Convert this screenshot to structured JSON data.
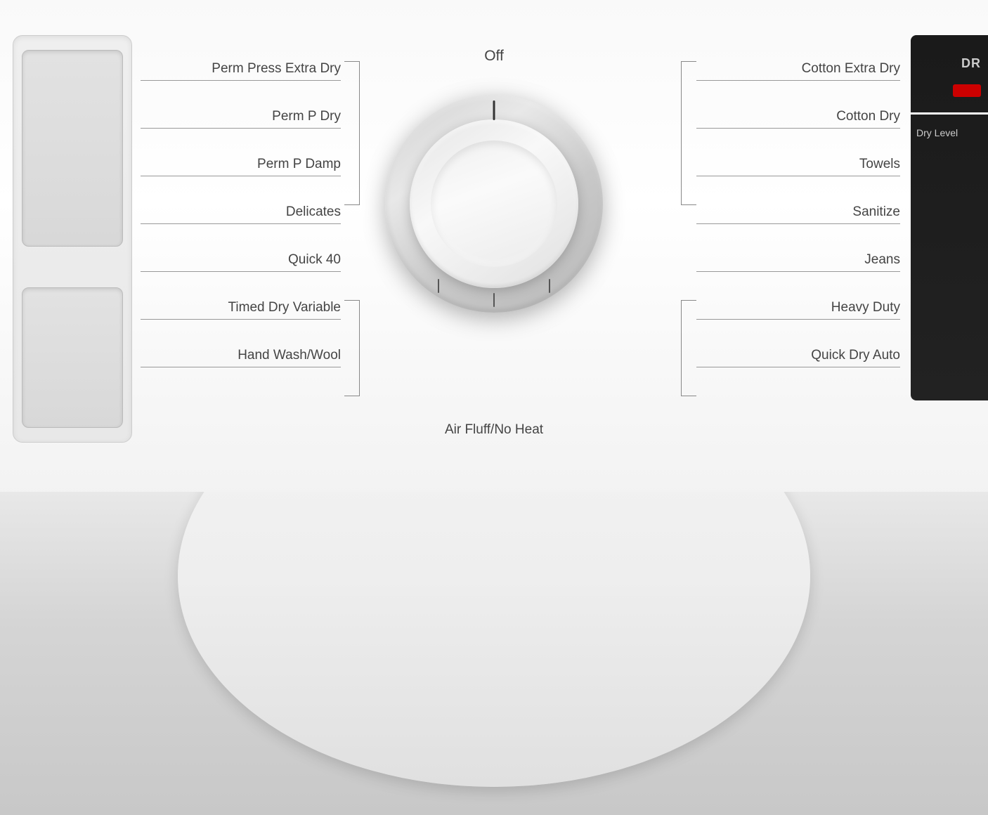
{
  "appliance": {
    "background_color": "#ffffff"
  },
  "dial": {
    "off_label": "Off",
    "air_fluff_label": "Air Fluff/No Heat"
  },
  "labels_left": [
    {
      "id": "perm-press-extra-dry",
      "text": "Perm Press Extra Dry"
    },
    {
      "id": "perm-p-dry",
      "text": "Perm P Dry"
    },
    {
      "id": "perm-p-damp",
      "text": "Perm P Damp"
    },
    {
      "id": "delicates",
      "text": "Delicates"
    },
    {
      "id": "quick-40",
      "text": "Quick 40"
    },
    {
      "id": "timed-dry-variable",
      "text": "Timed Dry Variable"
    },
    {
      "id": "hand-wash-wool",
      "text": "Hand Wash/Wool"
    }
  ],
  "labels_right": [
    {
      "id": "cotton-extra-dry",
      "text": "Cotton Extra Dry"
    },
    {
      "id": "cotton-dry",
      "text": "Cotton Dry"
    },
    {
      "id": "towels",
      "text": "Towels"
    },
    {
      "id": "sanitize",
      "text": "Sanitize"
    },
    {
      "id": "jeans",
      "text": "Jeans"
    },
    {
      "id": "heavy-duty",
      "text": "Heavy Duty"
    },
    {
      "id": "quick-dry-auto",
      "text": "Quick Dry Auto"
    }
  ],
  "right_module": {
    "dr_label": "DR",
    "dry_level_label": "Dry\nLevel"
  },
  "icons": {
    "red_indicator": "red-indicator-icon"
  }
}
